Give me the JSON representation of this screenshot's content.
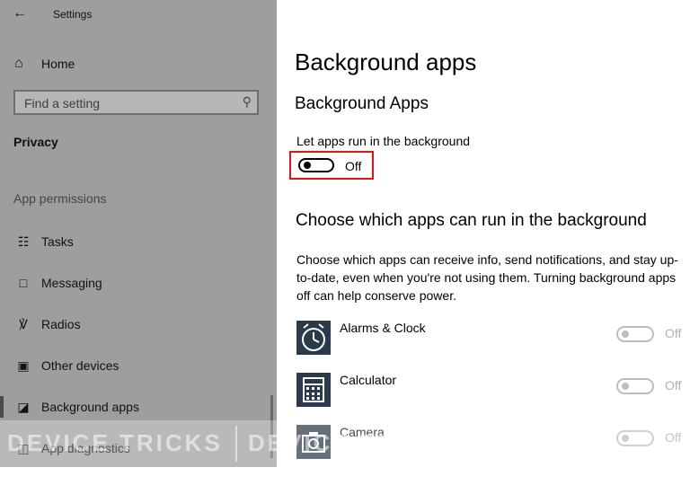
{
  "window": {
    "title": "Settings"
  },
  "sidebar": {
    "home_label": "Home",
    "search_placeholder": "Find a setting",
    "section": "Privacy",
    "group": "App permissions",
    "items": [
      {
        "label": "Tasks",
        "icon": "tasks-icon"
      },
      {
        "label": "Messaging",
        "icon": "messaging-icon"
      },
      {
        "label": "Radios",
        "icon": "radios-icon"
      },
      {
        "label": "Other devices",
        "icon": "other-devices-icon"
      },
      {
        "label": "Background apps",
        "icon": "background-apps-icon",
        "selected": true
      },
      {
        "label": "App diagnostics",
        "icon": "app-diagnostics-icon"
      }
    ]
  },
  "main": {
    "title": "Background apps",
    "subtitle": "Background Apps",
    "toggle_desc": "Let apps run in the background",
    "toggle_state": "Off",
    "apps_heading": "Choose which apps can run in the background",
    "apps_desc": "Choose which apps can receive info, send notifications, and stay up-to-date, even when you're not using them. Turning background apps off can help conserve power.",
    "apps": [
      {
        "name": "Alarms & Clock",
        "state": "Off",
        "icon": "alarms-clock-icon"
      },
      {
        "name": "Calculator",
        "state": "Off",
        "icon": "calculator-icon"
      },
      {
        "name": "Camera",
        "state": "Off",
        "icon": "camera-icon"
      }
    ]
  },
  "watermark": {
    "text": "DEVICE TRICKS"
  },
  "colors": {
    "sidebar_bg": "#9e9e9e",
    "highlight_border": "#ee1111",
    "app_icon_bg": "#2b3a4a"
  }
}
